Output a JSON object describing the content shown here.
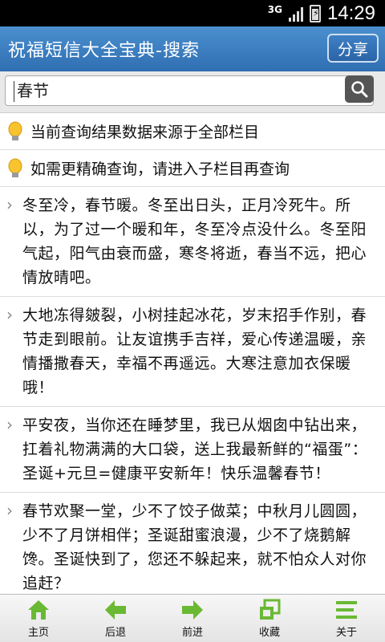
{
  "status_bar": {
    "network": "3G",
    "time": "14:29"
  },
  "app": {
    "title": "祝福短信大全宝典-搜索",
    "share_label": "分享"
  },
  "search": {
    "value": "春节"
  },
  "info": [
    "当前查询结果数据来源于全部栏目",
    "如需更精确查询，请进入子栏目再查询"
  ],
  "results": [
    "冬至冷，春节暖。冬至出日头，正月冷死牛。所以，为了过一个暖和年，冬至冷点没什么。冬至阳气起，阳气由衰而盛，寒冬将逝，春当不远，把心情放晴吧。",
    "大地冻得皴裂，小树挂起冰花，岁末招手作别，春节走到眼前。让友谊携手吉祥，爱心传递温暖，亲情播撒春天，幸福不再遥远。大寒注意加衣保暖哦！",
    "平安夜，当你还在睡梦里，我已从烟囱中钻出来，扛着礼物满满的大口袋，送上我最新鲜的“福蛋”：圣诞+元旦=健康平安新年！快乐温馨春节！",
    "春节欢聚一堂，少不了饺子做菜；中秋月儿圆圆，少不了月饼相伴；圣诞甜蜜浪漫，少不了烧鹅解馋。圣诞快到了，您还不躲起来，就不怕众人对你追赶？"
  ],
  "nav": [
    {
      "label": "主页",
      "icon": "home-icon"
    },
    {
      "label": "后退",
      "icon": "back-arrow-icon"
    },
    {
      "label": "前进",
      "icon": "forward-arrow-icon"
    },
    {
      "label": "收藏",
      "icon": "favorite-icon"
    },
    {
      "label": "关于",
      "icon": "about-icon"
    }
  ],
  "colors": {
    "titlebar": "#2f6eb2",
    "nav_icon": "#6ab934"
  }
}
